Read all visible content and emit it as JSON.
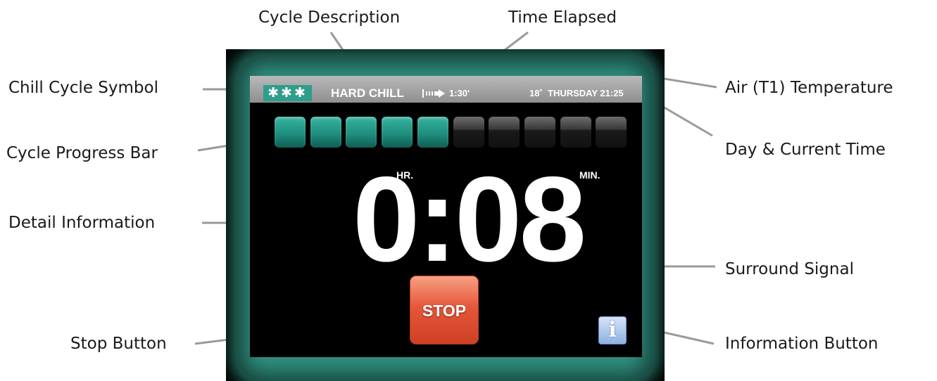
{
  "callouts": {
    "cycle_description": "Cycle Description",
    "time_elapsed": "Time Elapsed",
    "chill_cycle_symbol": "Chill Cycle Symbol",
    "air_temperature": "Air (T1) Temperature",
    "day_current_time": "Day & Current Time",
    "cycle_progress_bar": "Cycle Progress Bar",
    "detail_information": "Detail Information",
    "surround_signal": "Surround Signal",
    "stop_button": "Stop Button",
    "information_button": "Information Button"
  },
  "screen": {
    "chill_symbol": "✱✱✱",
    "cycle_description": "HARD CHILL",
    "elapsed_icon": "arrow-right-icon",
    "time_elapsed": "1:30'",
    "air_temperature": "18˚",
    "day_time": "THURSDAY 21:25",
    "progress": {
      "segments_total": 10,
      "segments_filled": 5
    },
    "unit_hours": "HR.",
    "unit_minutes": "MIN.",
    "detail_time": "0:08",
    "stop_label": "STOP",
    "info_label": "i"
  },
  "colors": {
    "surround_glow": "#2f8f7e",
    "progress_on": "#1e8f7f",
    "status_bar": "#a0a0a0",
    "stop_button": "#e6573a",
    "info_button": "#9dbbe6"
  }
}
